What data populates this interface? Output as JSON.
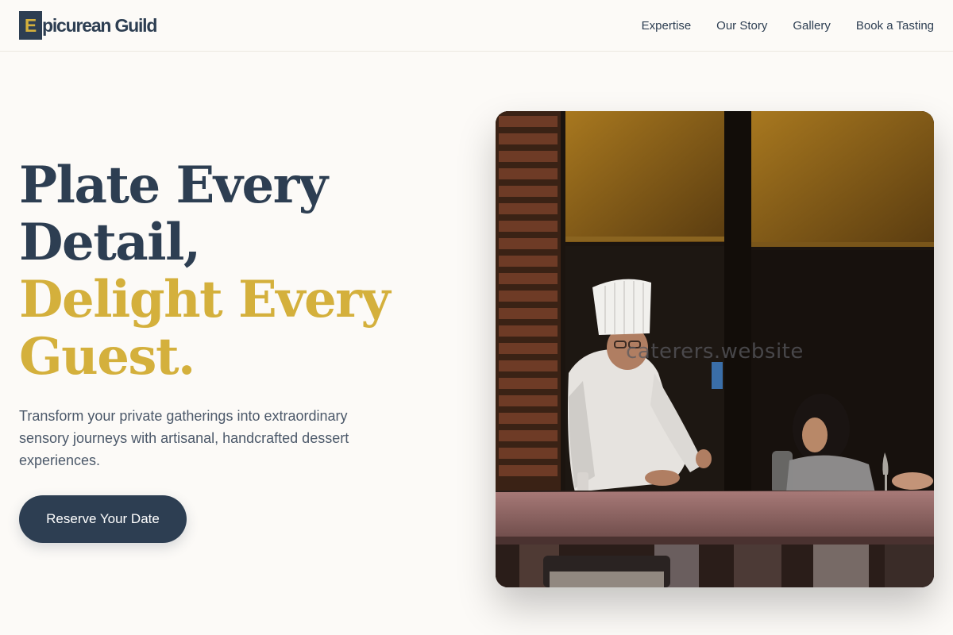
{
  "brand": {
    "mark": "E",
    "name": "picurean Guild"
  },
  "nav": {
    "items": [
      {
        "label": "Expertise"
      },
      {
        "label": "Our Story"
      },
      {
        "label": "Gallery"
      },
      {
        "label": "Book a Tasting"
      }
    ]
  },
  "hero": {
    "title_line1": "Plate Every",
    "title_line2": "Detail,",
    "title_line3": "Delight Every",
    "title_line4": "Guest.",
    "subtitle": "Transform your private gatherings into extraordinary sensory journeys with artisanal, handcrafted dessert experiences.",
    "cta_label": "Reserve Your Date",
    "image_watermark": "caterers.website"
  },
  "colors": {
    "brand_navy": "#2d3e52",
    "brand_gold": "#d4b03c",
    "background": "#fcfaf7"
  }
}
